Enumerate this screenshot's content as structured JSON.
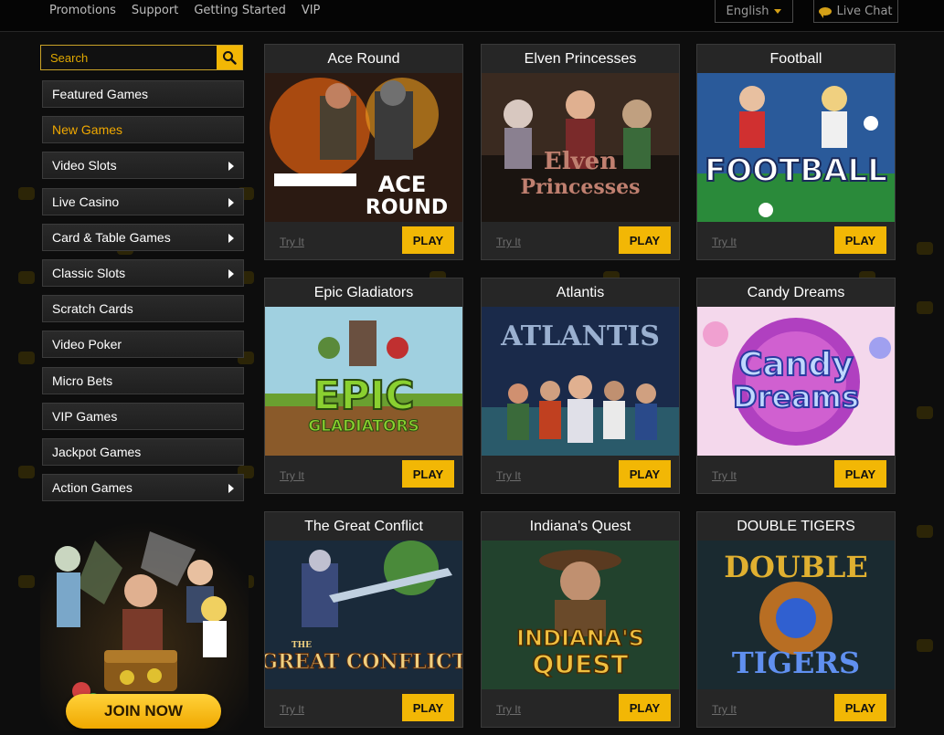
{
  "topnav": {
    "links": [
      "Promotions",
      "Support",
      "Getting Started",
      "VIP"
    ],
    "language": "English",
    "live_chat": "Live Chat"
  },
  "search": {
    "placeholder": "Search"
  },
  "sidebar": {
    "items": [
      {
        "label": "Featured Games",
        "arrow": false,
        "active": false
      },
      {
        "label": "New Games",
        "arrow": false,
        "active": true
      },
      {
        "label": "Video Slots",
        "arrow": true,
        "active": false
      },
      {
        "label": "Live Casino",
        "arrow": true,
        "active": false
      },
      {
        "label": "Card & Table Games",
        "arrow": true,
        "active": false
      },
      {
        "label": "Classic Slots",
        "arrow": true,
        "active": false
      },
      {
        "label": "Scratch Cards",
        "arrow": false,
        "active": false
      },
      {
        "label": "Video Poker",
        "arrow": false,
        "active": false
      },
      {
        "label": "Micro Bets",
        "arrow": false,
        "active": false
      },
      {
        "label": "VIP Games",
        "arrow": false,
        "active": false
      },
      {
        "label": "Jackpot Games",
        "arrow": false,
        "active": false
      },
      {
        "label": "Action Games",
        "arrow": true,
        "active": false
      }
    ]
  },
  "promo": {
    "join_label": "JOIN NOW"
  },
  "games": [
    {
      "title": "Ace Round",
      "art": [
        "ACE",
        "ROUND"
      ],
      "try": "Try It",
      "play": "PLAY"
    },
    {
      "title": "Elven Princesses",
      "art": [
        "Elven",
        "Princesses"
      ],
      "try": "Try It",
      "play": "PLAY"
    },
    {
      "title": "Football",
      "art": [
        "FOOTBALL"
      ],
      "try": "Try It",
      "play": "PLAY"
    },
    {
      "title": "Epic Gladiators",
      "art": [
        "EPIC",
        "GLADIATORS"
      ],
      "try": "Try It",
      "play": "PLAY"
    },
    {
      "title": "Atlantis",
      "art": [
        "ATLANTIS"
      ],
      "try": "Try It",
      "play": "PLAY"
    },
    {
      "title": "Candy Dreams",
      "art": [
        "Candy",
        "Dreams"
      ],
      "try": "Try It",
      "play": "PLAY"
    },
    {
      "title": "The Great Conflict",
      "art": [
        "THE",
        "GREAT CONFLICT"
      ],
      "try": "Try It",
      "play": "PLAY"
    },
    {
      "title": "Indiana's Quest",
      "art": [
        "INDIANA'S",
        "QUEST"
      ],
      "try": "Try It",
      "play": "PLAY"
    },
    {
      "title": "DOUBLE TIGERS",
      "art": [
        "DOUBLE",
        "TIGERS"
      ],
      "try": "Try It",
      "play": "PLAY"
    }
  ],
  "colors": {
    "accent": "#f2b705",
    "active_menu": "#f0a800",
    "background": "#0d0d0d"
  }
}
